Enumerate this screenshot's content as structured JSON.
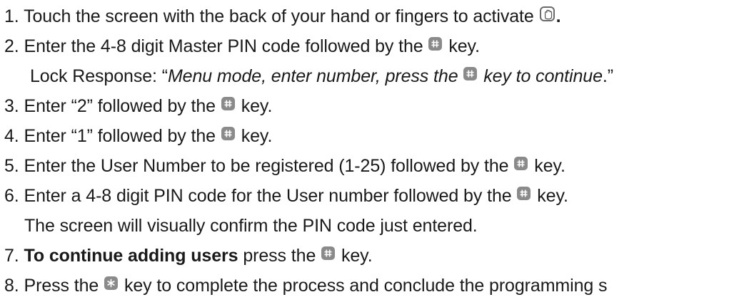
{
  "steps": [
    {
      "num": "1.",
      "pre": "Touch the screen with the back of your hand or fingers to activate",
      "post": "."
    },
    {
      "num": "2.",
      "pre": "Enter the 4-8 digit Master PIN code followed by the",
      "post": "key."
    },
    {
      "response_label": "Lock Response: “",
      "response_pre": "Menu mode, enter number, press the",
      "response_post": "key to continue",
      "response_end": ".”"
    },
    {
      "num": "3.",
      "pre": "Enter “2” followed by the",
      "post": "key."
    },
    {
      "num": "4.",
      "pre": "Enter “1” followed by the",
      "post": "key."
    },
    {
      "num": "5.",
      "pre": "Enter the User Number to be registered (1-25) followed by the",
      "post": "key."
    },
    {
      "num": "6.",
      "pre": "Enter a 4-8 digit PIN code for the User number followed by the",
      "post": "key."
    },
    {
      "note": "The screen will visually confirm the PIN code just entered."
    },
    {
      "num": "7.",
      "bold": "To continue adding users",
      "pre": "press the",
      "post": "key."
    },
    {
      "num": "8.",
      "pre": "Press the",
      "post": "key to complete the process and conclude the programming s"
    }
  ],
  "icons": {
    "hand": "hand-icon",
    "hash": "hash-key-icon",
    "star": "star-key-icon"
  }
}
